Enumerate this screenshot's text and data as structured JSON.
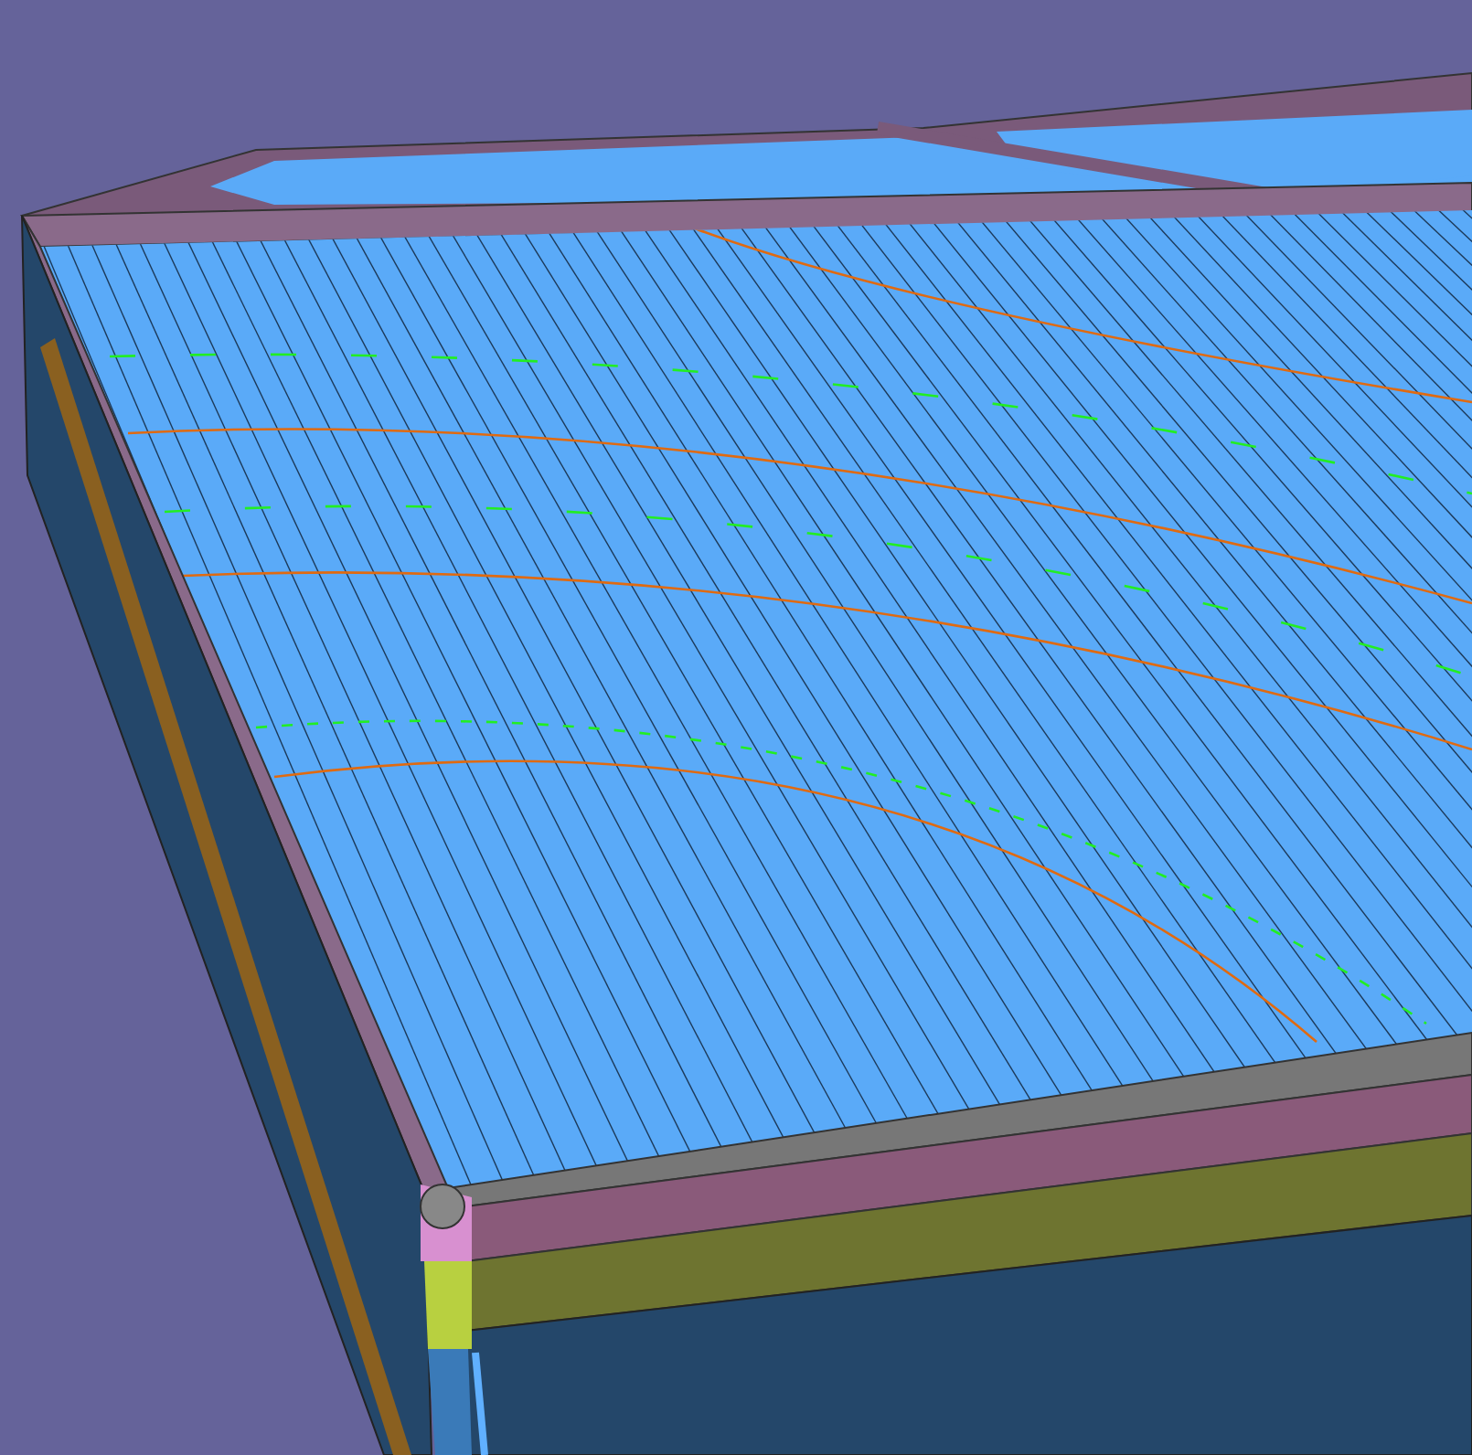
{
  "viewport": {
    "kind": "roof-model"
  }
}
